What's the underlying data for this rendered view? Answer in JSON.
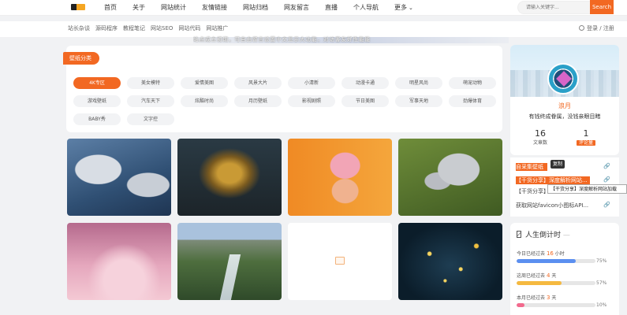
{
  "topnav": {
    "items": [
      "首页",
      "关于",
      "网站统计",
      "友情链接",
      "网站归档",
      "网友留言",
      "直播",
      "个人导航",
      "更多"
    ],
    "search_placeholder": "请输入关键字...",
    "search_button": "Search"
  },
  "subnav": {
    "items": [
      "站长杂谈",
      "源码程序",
      "教程笔记",
      "网站SEO",
      "网站代码",
      "网站推广"
    ],
    "login": "登录 / 注册"
  },
  "notice": "站点成立初期，可自由留言设置中文显示大功能，对访客友好性能能",
  "categories": {
    "title": "壁纸分类",
    "tags": [
      "4K专区",
      "美女模特",
      "爱情美图",
      "风景大片",
      "小清新",
      "动漫卡通",
      "明星风尚",
      "萌宠动物",
      "游戏壁纸",
      "汽车天下",
      "炫酷时尚",
      "月历壁纸",
      "影视剧照",
      "节日美图",
      "军事天地",
      "劲爆体育",
      "BABY秀",
      "文字控"
    ]
  },
  "profile": {
    "name": "浪月",
    "desc": "有钱终成眷属，没钱亲眼目睹",
    "articles_count": "16",
    "articles_label": "文章数",
    "comments_count": "1",
    "comments_label": "评论量"
  },
  "articles": {
    "rows": [
      "自采集壁纸",
      "【干货分享】深度解析网站...",
      "【干货分享】深度解析网站...",
      "获取网站favicon小图标API..."
    ],
    "tooltip_copy": "复制",
    "tooltip_title": "【干货分享】深度解析网站加载"
  },
  "countdown": {
    "title": "人生倒计时",
    "rows": [
      {
        "prefix": "今日已经过去",
        "value": "16",
        "unit": "小时",
        "percent": "75%",
        "fill": 0.75,
        "color": "#5b8ff0"
      },
      {
        "prefix": "这周已经过去",
        "value": "4",
        "unit": "天",
        "percent": "57%",
        "fill": 0.57,
        "color": "#f5b940"
      },
      {
        "prefix": "本月已经过去",
        "value": "3",
        "unit": "天",
        "percent": "10%",
        "fill": 0.1,
        "color": "#f26a8d"
      }
    ]
  }
}
